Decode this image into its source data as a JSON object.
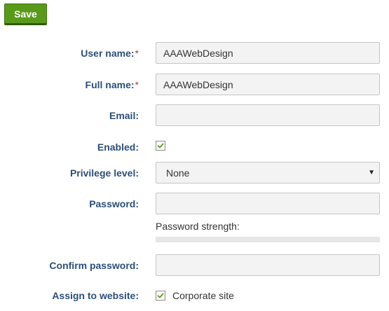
{
  "toolbar": {
    "save_label": "Save"
  },
  "form": {
    "user_name": {
      "label": "User name:",
      "required_mark": "*",
      "value": "AAAWebDesign"
    },
    "full_name": {
      "label": "Full name:",
      "required_mark": "*",
      "value": "AAAWebDesign"
    },
    "email": {
      "label": "Email:",
      "value": ""
    },
    "enabled": {
      "label": "Enabled:",
      "checked": true
    },
    "privilege_level": {
      "label": "Privilege level:",
      "selected": "None"
    },
    "password": {
      "label": "Password:",
      "value": "",
      "strength_label": "Password strength:"
    },
    "confirm_password": {
      "label": "Confirm password:",
      "value": ""
    },
    "assign_to_website": {
      "label": "Assign to website:",
      "checked": true,
      "site_label": "Corporate site"
    }
  },
  "colors": {
    "accent": "#5a9a1a",
    "label_text": "#2b4f7a",
    "required_mark": "#c0392b",
    "check_mark": "#5a9a1a"
  }
}
